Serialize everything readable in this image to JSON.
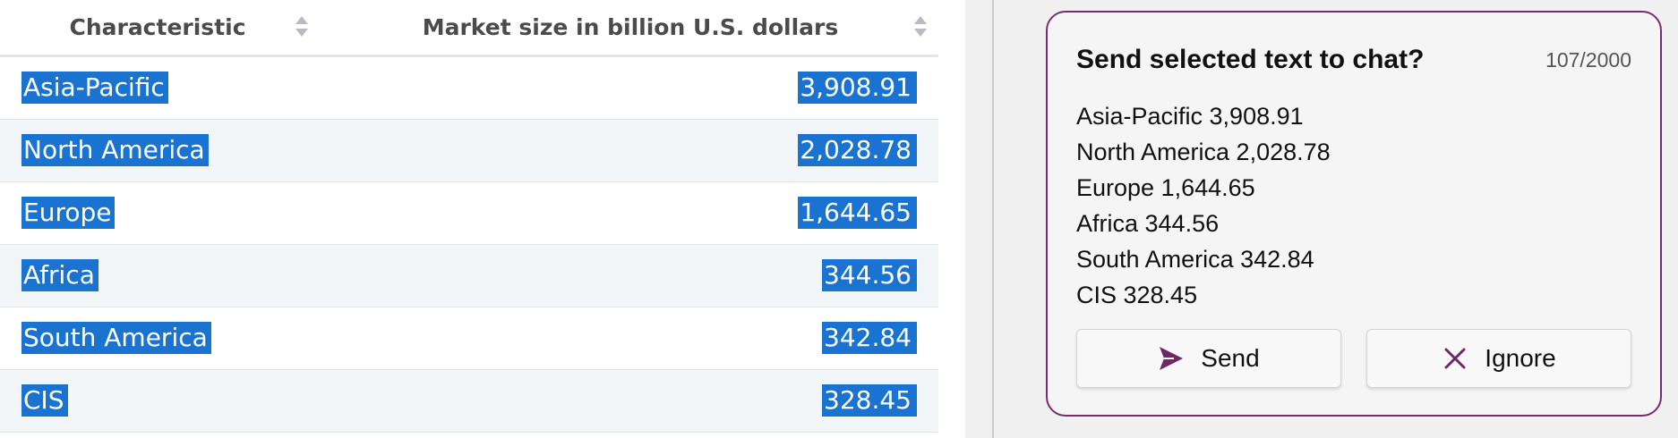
{
  "table": {
    "columns": [
      "Characteristic",
      "Market size in billion U.S. dollars"
    ],
    "rows": [
      {
        "name": "Asia-Pacific",
        "value": "3,908.91"
      },
      {
        "name": "North America",
        "value": "2,028.78"
      },
      {
        "name": "Europe",
        "value": "1,644.65"
      },
      {
        "name": "Africa",
        "value": "344.56"
      },
      {
        "name": "South America",
        "value": "342.84"
      },
      {
        "name": "CIS",
        "value": "328.45"
      }
    ]
  },
  "popup": {
    "title": "Send selected text to chat?",
    "char_count": "107/2000",
    "lines": [
      "Asia-Pacific 3,908.91",
      "North America 2,028.78",
      "Europe 1,644.65",
      "Africa 344.56",
      "South America 342.84",
      "CIS 328.45"
    ],
    "send_label": "Send",
    "ignore_label": "Ignore"
  },
  "colors": {
    "selection": "#1a73d0",
    "popup_border": "#7a2a6e",
    "send_icon": "#6e2863",
    "ignore_icon": "#6e2863"
  },
  "icons": {
    "sort": "sort-icon",
    "send": "send-icon",
    "ignore": "close-icon"
  }
}
